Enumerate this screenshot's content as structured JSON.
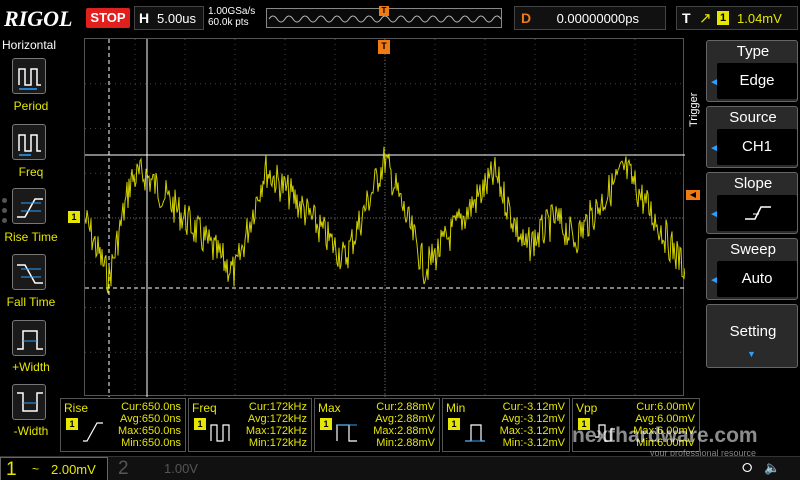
{
  "header": {
    "logo": "RIGOL",
    "run_state": "STOP",
    "horizontal_key": "H",
    "timebase": "5.00us",
    "sample_rate": "1.00GSa/s",
    "memory_points": "60.0k pts",
    "trigger_marker": "T",
    "delay_key": "D",
    "delay_value": "0.00000000ps",
    "trigger_key": "T",
    "trigger_channel": "1",
    "trigger_level": "1.04mV"
  },
  "left_menu": {
    "title": "Horizontal",
    "items": [
      {
        "label": "Period"
      },
      {
        "label": "Freq"
      },
      {
        "label": "Rise Time"
      },
      {
        "label": "Fall Time"
      },
      {
        "label": "+Width"
      },
      {
        "label": "-Width"
      }
    ]
  },
  "channel_marker": "1",
  "right_menu": {
    "side_label": "Trigger",
    "type": {
      "title": "Type",
      "value": "Edge"
    },
    "source": {
      "title": "Source",
      "value": "CH1"
    },
    "slope": {
      "title": "Slope",
      "value": ""
    },
    "sweep": {
      "title": "Sweep",
      "value": "Auto"
    },
    "setting": {
      "title": "Setting"
    }
  },
  "measurements": [
    {
      "title": "Rise",
      "channel": "1",
      "lines": [
        "Cur:650.0ns",
        "Avg:650.0ns",
        "Max:650.0ns",
        "Min:650.0ns"
      ]
    },
    {
      "title": "Freq",
      "channel": "1",
      "lines": [
        "Cur:172kHz",
        "Avg:172kHz",
        "Max:172kHz",
        "Min:172kHz"
      ]
    },
    {
      "title": "Max",
      "channel": "1",
      "lines": [
        "Cur:2.88mV",
        "Avg:2.88mV",
        "Max:2.88mV",
        "Min:2.88mV"
      ]
    },
    {
      "title": "Min",
      "channel": "1",
      "lines": [
        "Cur:-3.12mV",
        "Avg:-3.12mV",
        "Max:-3.12mV",
        "Min:-3.12mV"
      ]
    },
    {
      "title": "Vpp",
      "channel": "1",
      "lines": [
        "Cur:6.00mV",
        "Avg:6.00mV",
        "Max:6.00mV",
        "Min:6.00mV"
      ]
    }
  ],
  "bottom": {
    "ch1_num": "1",
    "ch1_coupling": "~",
    "ch1_scale": "2.00mV",
    "ch2_num": "2",
    "ch2_scale": "1.00V"
  },
  "watermark": {
    "brand": "nexthardware.com",
    "tagline": "your professional resource"
  },
  "colors": {
    "ch1": "#e6e600",
    "trigger": "#f07b12",
    "stop": "#e0201c",
    "accent": "#2aa0ff"
  }
}
